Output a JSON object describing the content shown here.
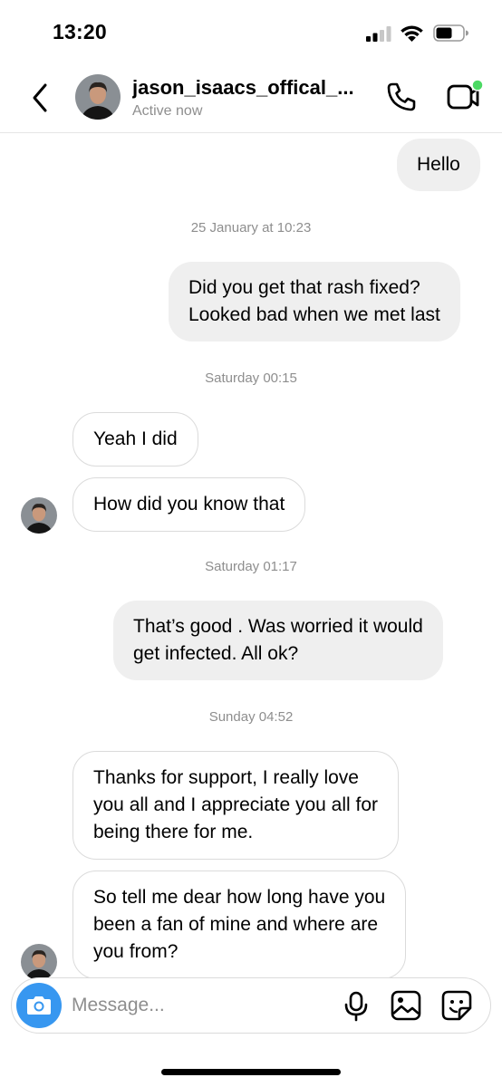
{
  "status_bar": {
    "time": "13:20"
  },
  "header": {
    "name": "jason_isaacs_offical_...",
    "status": "Active now"
  },
  "messages": [
    {
      "kind": "out",
      "text": "Hello"
    },
    {
      "kind": "timestamp",
      "text": "25 January at 10:23"
    },
    {
      "kind": "out",
      "lines": [
        "Did you get that rash fixed?",
        "Looked bad when we met last"
      ]
    },
    {
      "kind": "timestamp",
      "text": "Saturday 00:15"
    },
    {
      "kind": "in",
      "text": "Yeah I did"
    },
    {
      "kind": "in",
      "text": "How did you know that"
    },
    {
      "kind": "timestamp",
      "text": "Saturday 01:17"
    },
    {
      "kind": "out",
      "lines": [
        "That’s good .  Was worried it would",
        "get infected.  All ok?"
      ]
    },
    {
      "kind": "timestamp",
      "text": "Sunday 04:52"
    },
    {
      "kind": "in",
      "lines": [
        "Thanks for support, I really love",
        "you all and I appreciate you all for",
        "being there for me."
      ]
    },
    {
      "kind": "in",
      "lines": [
        "So tell me dear how long have you",
        "been a fan of mine and where are",
        "you from?"
      ]
    }
  ],
  "composer": {
    "placeholder": "Message..."
  },
  "icons": {
    "back": "chevron-left-icon",
    "call": "phone-icon",
    "video": "video-camera-icon",
    "camera": "camera-icon",
    "mic": "microphone-icon",
    "gallery": "image-icon",
    "sticker": "sticker-icon"
  },
  "colors": {
    "accent": "#3797f0",
    "online": "#4cd964",
    "outgoing_bubble": "#efefef",
    "muted_text": "#8e8e8e"
  }
}
